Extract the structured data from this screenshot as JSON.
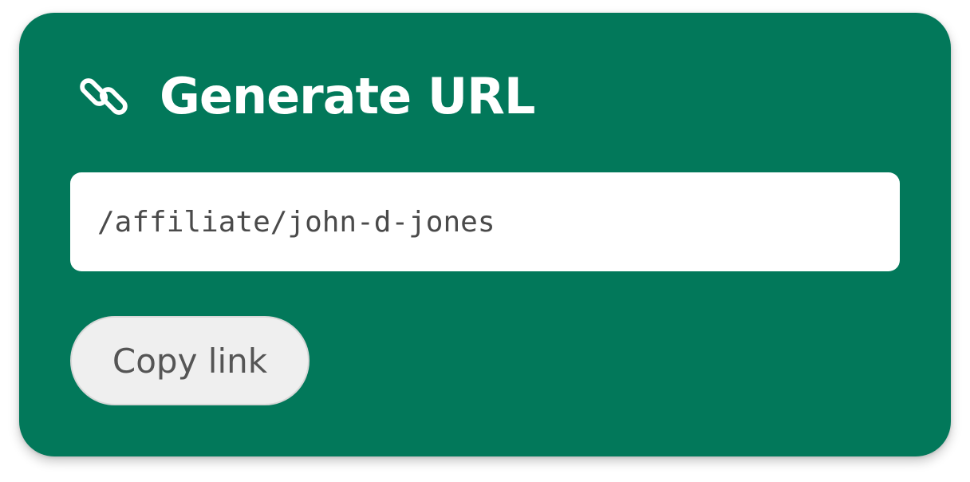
{
  "card": {
    "title": "Generate URL",
    "title_icon": "link-icon",
    "background_color": "#02785a"
  },
  "url_field": {
    "value": "/affiliate/john-d-jones"
  },
  "copy_button": {
    "label": "Copy link"
  }
}
